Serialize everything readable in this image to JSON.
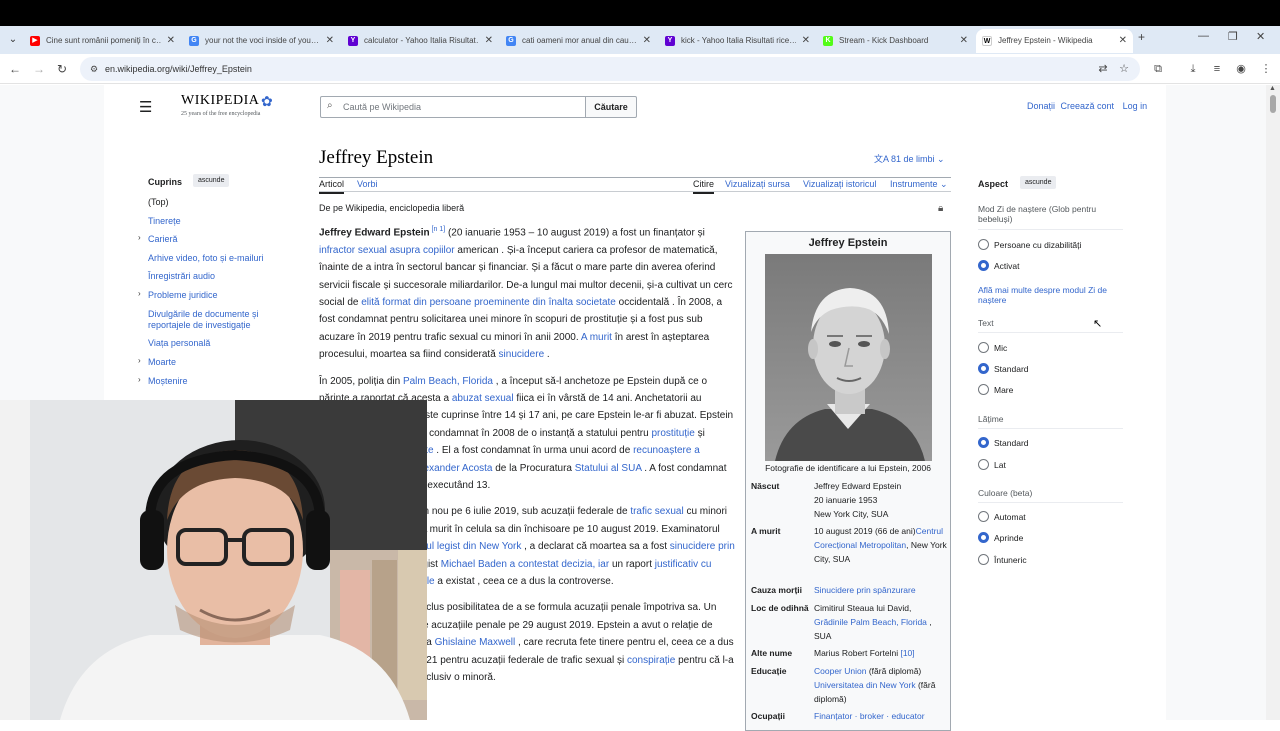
{
  "browser": {
    "tabs": [
      {
        "label": "Cine sunt românii pomeniți în c…",
        "fav_color": "#ff0000",
        "fav": "▶"
      },
      {
        "label": "your not the voci inside of you…",
        "fav_color": "#4285f4",
        "fav": "G"
      },
      {
        "label": "calculator - Yahoo Italia Risultat…",
        "fav_color": "#6001d2",
        "fav": "Y"
      },
      {
        "label": "cati oameni mor anual din cau…",
        "fav_color": "#4285f4",
        "fav": "G"
      },
      {
        "label": "kick - Yahoo Italia Risultati rice…",
        "fav_color": "#6001d2",
        "fav": "Y"
      },
      {
        "label": "Stream - Kick Dashboard",
        "fav_color": "#53fc18",
        "fav": "K"
      },
      {
        "label": "Jeffrey Epstein - Wikipedia",
        "fav_color": "#ffffff",
        "fav": "W"
      }
    ],
    "url": "en.wikipedia.org/wiki/Jeffrey_Epstein"
  },
  "wiki": {
    "wordmark": "WIKIPEDIA",
    "tagline": "25 years of the free encyclopedia",
    "search_placeholder": "Caută pe Wikipedia",
    "search_button": "Căutare",
    "user_links": [
      "Donații",
      "Creează cont",
      "Log in"
    ],
    "title": "Jeffrey Epstein",
    "languages": "81 de limbi",
    "tabs_left": [
      "Articol",
      "Vorbi"
    ],
    "tabs_right": [
      "Citire",
      "Vizualizați sursa",
      "Vizualizați istoricul",
      "Instrumente"
    ],
    "from_wiki": "De pe Wikipedia, enciclopedia liberă",
    "toc": {
      "title": "Cuprins",
      "hide": "ascunde",
      "items": [
        "(Top)",
        "Tinerețe",
        "Carieră",
        "Arhive video, foto și e-mailuri",
        "Înregistrări audio",
        "Probleme juridice",
        "Divulgările de documente și reportajele de investigație",
        "Viața personală",
        "Moarte",
        "Moștenire"
      ]
    },
    "article": {
      "p1": [
        {
          "t": "Jeffrey Edward Epstein",
          "b": true
        },
        {
          "t": " [n 1]",
          "sup": true
        },
        {
          "t": " (20 ianuarie 1953 – 10 august 2019) a fost un finanțator și "
        },
        {
          "t": "infractor sexual asupra copiilor",
          "l": true
        },
        {
          "t": " american . Și-a început cariera ca profesor de matematică, înainte de a intra în sectorul bancar și financiar. Și a făcut o mare parte din averea oferind servicii fiscale și succesorale miliardarilor. De-a lungul mai multor decenii, și-a cultivat un cerc social de "
        },
        {
          "t": "elită format din persoane proeminente din înalta societate",
          "l": true
        },
        {
          "t": " occidentală . În 2008, a fost condamnat pentru solicitarea unei minore în scopuri de prostituție și a fost pus sub acuzare în 2019 pentru trafic sexual cu minori în anii 2000. "
        },
        {
          "t": "A murit",
          "l": true
        },
        {
          "t": " în arest în așteptarea procesului, moartea sa fiind considerată "
        },
        {
          "t": "sinucidere",
          "l": true
        },
        {
          "t": " ."
        }
      ],
      "p2": [
        {
          "t": "În 2005, poliția din "
        },
        {
          "t": "Palm Beach, Florida",
          "l": true
        },
        {
          "t": " , a început să-l anchetoze pe Epstein după ce o părinte a raportat că acesta a "
        },
        {
          "t": "abuzat sexual",
          "l": true
        },
        {
          "t": " fiica ei în vârstă de 14 ani. Anchetatorii au identificat victime cu vârste cuprinse între 14 și 17 ani, pe care Epstein le-ar fi abuzat. Epstein a "
        },
        {
          "t": "pledat vinovat",
          "l": true
        },
        {
          "t": " și a fost condamnat în 2008 de o instanță a statului pentru "
        },
        {
          "t": "prostituție",
          "l": true
        },
        {
          "t": " și rambursare "
        },
        {
          "t": "de prostituate",
          "l": true
        },
        {
          "t": " . El a fost condamnat în urma unui acord de "
        },
        {
          "t": "recunoaștere a vinovăției",
          "l": true
        },
        {
          "t": " încheiat de "
        },
        {
          "t": "Alexander Acosta",
          "l": true
        },
        {
          "t": " de la Procuratura "
        },
        {
          "t": "Statului al SUA",
          "l": true
        },
        {
          "t": " . A fost condamnat la 18 luni de închisoare, executând 13."
        }
      ],
      "p3": [
        {
          "t": "Epstein a fost arestat din nou pe 6 iulie 2019, sub acuzații federale de "
        },
        {
          "t": "trafic sexual",
          "l": true
        },
        {
          "t": " cu minori în Florida și New York. A murit în celula sa din închisoare pe 10 august 2019. Examinatorul medical de atunci "
        },
        {
          "t": "medicul legist din New York",
          "l": true
        },
        {
          "t": " , a declarat că moartea sa a fost "
        },
        {
          "t": "sinucidere prin spânzurare",
          "l": true
        },
        {
          "t": " . Medicul legist "
        },
        {
          "t": "Michael Baden a contestat decizia, iar",
          "l": true
        },
        {
          "t": " un raport "
        },
        {
          "t": "justificativ cu privire la cauza morții sale",
          "l": true
        },
        {
          "t": " a existat , ceea ce a dus la controverse."
        }
      ],
      "p4": [
        {
          "t": "Moartea lui Epstein a exclus posibilitatea de a se formula acuzații penale împotriva sa. Un judecător a respins toate acuzațiile penale pe 29 august 2019. Epstein a avut o relație de lungă durată cu socialista "
        },
        {
          "t": "Ghislaine Maxwell",
          "l": true
        },
        {
          "t": " , care recruta fete tinere pentru el, ceea ce a dus la condamnarea ei în 2021 pentru acuzații federale de trafic sexual și "
        },
        {
          "t": "conspirație",
          "l": true
        },
        {
          "t": " pentru că l-a ajutat să procure fete, inclusiv o minoră."
        }
      ]
    },
    "infobox": {
      "title": "Jeffrey Epstein",
      "caption": "Fotografie de identificare a lui Epstein, 2006",
      "rows": [
        {
          "k": "Născut",
          "v": [
            {
              "t": "Jeffrey Edward Epstein"
            },
            {
              "t": "20 ianuarie 1953"
            },
            {
              "t": "New York City, SUA"
            }
          ]
        },
        {
          "k": "A murit",
          "v": [
            {
              "t": "10 august 2019 (66 de ani)"
            },
            {
              "t": "Centrul Corecțional Metropolitan",
              "l": true
            },
            {
              "t": ", New York City, SUA"
            }
          ]
        },
        {
          "k": "Cauza morții",
          "v": [
            {
              "t": "Sinucidere prin spânzurare",
              "l": true
            }
          ]
        },
        {
          "k": "Loc de odihnă",
          "v": [
            {
              "t": "Cimitirul Steaua lui David, "
            },
            {
              "t": "Grădinile Palm Beach, Florida",
              "l": true
            },
            {
              "t": " , SUA"
            }
          ]
        },
        {
          "k": "Alte nume",
          "v": [
            {
              "t": "Marius Robert Fortelni"
            },
            {
              "t": " [10]",
              "l": true
            }
          ]
        },
        {
          "k": "Educație",
          "v": [
            {
              "t": "Cooper Union",
              "l": true
            },
            {
              "t": " (fără diplomă)"
            },
            {
              "t": " Universitatea din New York",
              "l": true
            },
            {
              "t": " (fără diplomă)"
            }
          ]
        },
        {
          "k": "Ocupații",
          "v": [
            {
              "t": "Finanțator · broker · educator",
              "l": true
            }
          ]
        }
      ]
    },
    "aspect": {
      "title": "Aspect",
      "hide": "ascunde",
      "mode_label": "Mod Zi de naștere (Glob pentru bebeluși)",
      "mode_options": [
        {
          "label": "Persoane cu dizabilități",
          "on": false
        },
        {
          "label": "Activat",
          "on": true
        }
      ],
      "mode_link": "Află mai multe despre modul Zi de naștere",
      "text_label": "Text",
      "text_options": [
        {
          "label": "Mic",
          "on": false
        },
        {
          "label": "Standard",
          "on": true
        },
        {
          "label": "Mare",
          "on": false
        }
      ],
      "width_label": "Lățime",
      "width_options": [
        {
          "label": "Standard",
          "on": true
        },
        {
          "label": "Lat",
          "on": false
        }
      ],
      "color_label": "Culoare (beta)",
      "color_options": [
        {
          "label": "Automat",
          "on": false
        },
        {
          "label": "Aprinde",
          "on": true
        },
        {
          "label": "Întuneric",
          "on": false
        }
      ]
    }
  }
}
